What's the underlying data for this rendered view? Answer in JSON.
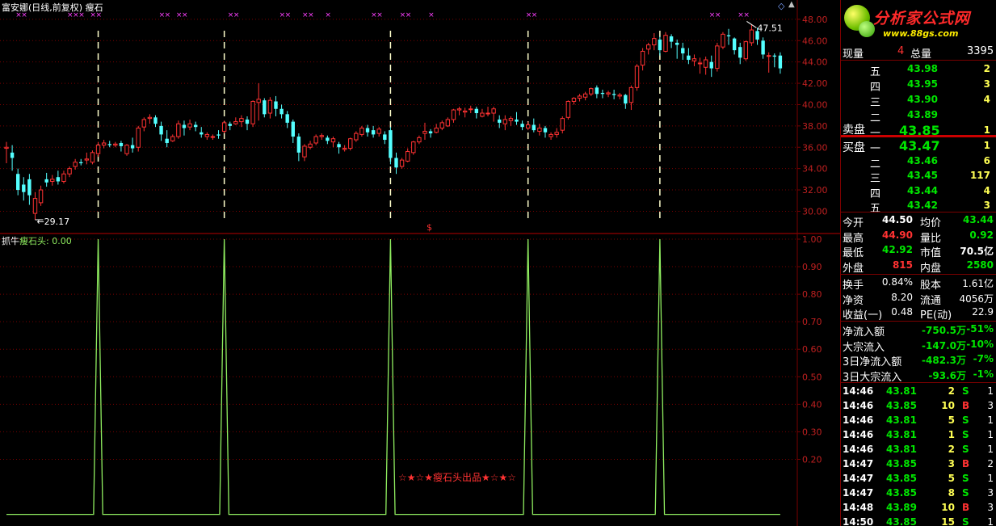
{
  "chart_header": {
    "title": "富安娜(日线,前复权) 瘦石",
    "indicator_name": "抓牛",
    "indicator_line": "瘦石头: 0.00",
    "watermark": "☆★☆★瘦石头出品★☆★☆",
    "max_label": "47.51",
    "min_label": "29.17",
    "marker": "$"
  },
  "colors": {
    "up": "#ff3232",
    "down": "#54ffff",
    "indicator": "#90ee60",
    "grid": "#7a0000",
    "axis_text": "#c02020"
  },
  "chart_data": [
    {
      "type": "candlestick",
      "y_ticks": [
        30,
        32,
        34,
        36,
        38,
        40,
        42,
        44,
        46,
        48
      ],
      "y_tick_labels": [
        "30.00",
        "32.00",
        "34.00",
        "36.00",
        "38.00",
        "40.00",
        "42.00",
        "44.00",
        "46.00",
        "48.00"
      ],
      "ylim": [
        29.2,
        48.9
      ],
      "candles": [
        [
          35.9,
          36.5,
          36.0,
          34.5
        ],
        [
          35.5,
          36.2,
          35.0,
          33.8
        ],
        [
          33.5,
          34.0,
          32.0,
          31.5
        ],
        [
          32.5,
          33.2,
          31.8,
          31.0
        ],
        [
          33.0,
          33.5,
          31.5,
          30.6
        ],
        [
          29.8,
          31.8,
          31.2,
          29.2
        ],
        [
          30.8,
          32.4,
          32.0,
          30.5
        ],
        [
          33.0,
          33.6,
          32.7,
          32.3
        ],
        [
          32.8,
          33.4,
          33.0,
          32.4
        ],
        [
          33.2,
          33.8,
          32.8,
          32.5
        ],
        [
          32.8,
          33.8,
          33.5,
          32.6
        ],
        [
          33.5,
          34.2,
          34.0,
          33.2
        ],
        [
          34.2,
          34.9,
          34.6,
          33.9
        ],
        [
          34.6,
          34.9,
          34.5,
          34.3
        ],
        [
          34.8,
          35.5,
          34.9,
          34.4
        ],
        [
          34.6,
          35.7,
          35.5,
          34.4
        ],
        [
          35.4,
          36.5,
          36.2,
          35.1
        ],
        [
          36.2,
          36.7,
          36.4,
          35.9
        ],
        [
          36.3,
          36.6,
          36.2,
          36.0
        ],
        [
          36.2,
          36.5,
          36.3,
          36.0
        ],
        [
          36.4,
          36.6,
          36.1,
          35.6
        ],
        [
          35.4,
          36.3,
          36.2,
          35.2
        ],
        [
          36.2,
          36.9,
          35.9,
          35.5
        ],
        [
          36.0,
          38.0,
          37.8,
          35.6
        ],
        [
          37.9,
          38.8,
          38.6,
          37.5
        ],
        [
          38.7,
          39.1,
          38.8,
          38.2
        ],
        [
          38.8,
          39.0,
          38.2,
          37.9
        ],
        [
          38.0,
          38.4,
          37.2,
          36.6
        ],
        [
          36.8,
          37.6,
          36.4,
          36.0
        ],
        [
          36.6,
          37.2,
          37.0,
          36.5
        ],
        [
          37.0,
          38.5,
          38.2,
          36.8
        ],
        [
          38.1,
          38.5,
          37.8,
          37.1
        ],
        [
          37.9,
          38.6,
          38.2,
          37.6
        ],
        [
          38.1,
          38.4,
          37.9,
          37.5
        ],
        [
          37.4,
          37.9,
          37.2,
          36.9
        ],
        [
          37.0,
          37.4,
          37.2,
          36.7
        ],
        [
          37.0,
          37.2,
          37.0,
          36.7
        ],
        [
          37.2,
          37.6,
          37.1,
          36.8
        ],
        [
          37.5,
          38.5,
          38.3,
          37.3
        ],
        [
          38.2,
          38.4,
          38.0,
          37.6
        ],
        [
          38.2,
          38.8,
          38.4,
          38.1
        ],
        [
          38.4,
          39.0,
          38.7,
          37.9
        ],
        [
          38.6,
          38.9,
          38.2,
          37.6
        ],
        [
          38.2,
          40.4,
          40.3,
          37.9
        ],
        [
          40.2,
          42.0,
          40.5,
          38.5
        ],
        [
          40.4,
          40.6,
          39.1,
          38.8
        ],
        [
          39.2,
          40.7,
          40.4,
          38.7
        ],
        [
          40.3,
          40.8,
          39.6,
          38.9
        ],
        [
          39.6,
          40.0,
          39.1,
          38.7
        ],
        [
          39.1,
          39.4,
          38.3,
          37.8
        ],
        [
          38.4,
          38.6,
          37.0,
          36.4
        ],
        [
          37.0,
          37.3,
          35.5,
          34.7
        ],
        [
          35.1,
          36.3,
          36.1,
          34.7
        ],
        [
          36.0,
          36.6,
          36.3,
          35.8
        ],
        [
          36.4,
          37.2,
          37.0,
          36.2
        ],
        [
          37.0,
          37.3,
          37.1,
          36.7
        ],
        [
          36.9,
          37.1,
          36.6,
          36.3
        ],
        [
          36.5,
          37.0,
          36.8,
          36.0
        ],
        [
          36.3,
          36.5,
          36.0,
          35.4
        ],
        [
          35.8,
          36.2,
          35.9,
          35.6
        ],
        [
          35.9,
          36.9,
          36.8,
          35.7
        ],
        [
          36.7,
          37.5,
          37.3,
          36.5
        ],
        [
          37.2,
          38.0,
          37.8,
          37.0
        ],
        [
          37.8,
          38.1,
          37.4,
          37.0
        ],
        [
          37.6,
          38.0,
          37.2,
          36.9
        ],
        [
          37.3,
          37.9,
          37.7,
          37.0
        ],
        [
          37.2,
          37.5,
          36.7,
          36.3
        ],
        [
          37.6,
          37.9,
          35.0,
          34.4
        ],
        [
          35.0,
          35.5,
          34.1,
          33.5
        ],
        [
          34.2,
          35.0,
          34.8,
          34.0
        ],
        [
          34.7,
          35.9,
          35.6,
          34.6
        ],
        [
          35.5,
          36.6,
          36.5,
          35.3
        ],
        [
          36.5,
          37.1,
          36.9,
          36.3
        ],
        [
          37.3,
          38.3,
          37.5,
          36.7
        ],
        [
          37.5,
          37.7,
          37.3,
          36.9
        ],
        [
          37.4,
          38.2,
          37.8,
          37.3
        ],
        [
          37.8,
          38.5,
          38.3,
          37.6
        ],
        [
          38.0,
          38.8,
          38.6,
          37.9
        ],
        [
          38.6,
          39.6,
          39.5,
          38.3
        ],
        [
          39.5,
          39.8,
          39.6,
          39.0
        ],
        [
          39.3,
          39.7,
          39.4,
          38.8
        ],
        [
          39.6,
          39.9,
          39.6,
          39.2
        ],
        [
          39.6,
          39.8,
          39.2,
          38.7
        ],
        [
          38.9,
          39.6,
          39.2,
          38.8
        ],
        [
          39.2,
          39.8,
          39.2,
          38.9
        ],
        [
          39.2,
          39.8,
          39.6,
          38.4
        ],
        [
          38.6,
          39.0,
          38.3,
          37.8
        ],
        [
          38.2,
          39.0,
          38.6,
          37.6
        ],
        [
          38.5,
          38.9,
          38.7,
          38.0
        ],
        [
          38.6,
          39.3,
          38.4,
          38.1
        ],
        [
          38.2,
          38.5,
          37.9,
          37.6
        ],
        [
          37.8,
          38.4,
          38.1,
          37.6
        ],
        [
          38.1,
          38.7,
          37.6,
          37.4
        ],
        [
          37.5,
          38.2,
          37.8,
          37.1
        ],
        [
          37.8,
          38.0,
          37.4,
          36.9
        ],
        [
          37.0,
          37.4,
          37.2,
          36.7
        ],
        [
          37.2,
          37.8,
          37.4,
          36.9
        ],
        [
          37.6,
          38.9,
          38.7,
          37.3
        ],
        [
          38.8,
          40.4,
          40.3,
          38.6
        ],
        [
          40.3,
          40.7,
          40.6,
          40.0
        ],
        [
          40.6,
          41.0,
          40.8,
          40.3
        ],
        [
          40.7,
          41.2,
          41.0,
          40.4
        ],
        [
          41.0,
          41.6,
          41.5,
          40.8
        ],
        [
          41.6,
          41.8,
          41.0,
          40.6
        ],
        [
          41.1,
          41.4,
          41.0,
          40.6
        ],
        [
          41.0,
          41.3,
          41.1,
          40.7
        ],
        [
          41.0,
          41.4,
          40.9,
          40.5
        ],
        [
          40.8,
          41.1,
          40.9,
          40.5
        ],
        [
          40.9,
          41.0,
          40.1,
          39.6
        ],
        [
          40.2,
          41.8,
          41.6,
          39.5
        ],
        [
          41.6,
          43.8,
          43.6,
          41.3
        ],
        [
          43.7,
          45.3,
          45.0,
          43.2
        ],
        [
          45.2,
          45.8,
          45.6,
          44.7
        ],
        [
          45.6,
          46.7,
          46.2,
          45.1
        ],
        [
          46.1,
          46.4,
          45.1,
          44.6
        ],
        [
          45.0,
          46.8,
          46.5,
          44.9
        ],
        [
          46.4,
          46.6,
          45.9,
          45.3
        ],
        [
          45.8,
          46.1,
          45.6,
          44.3
        ],
        [
          45.3,
          45.8,
          44.8,
          44.2
        ],
        [
          44.6,
          45.3,
          44.2,
          43.8
        ],
        [
          44.1,
          44.7,
          44.3,
          43.6
        ],
        [
          43.9,
          44.4,
          43.9,
          42.9
        ],
        [
          43.5,
          44.5,
          44.2,
          42.8
        ],
        [
          44.0,
          44.6,
          43.4,
          42.6
        ],
        [
          43.4,
          45.8,
          45.5,
          43.1
        ],
        [
          45.4,
          46.8,
          46.6,
          45.2
        ],
        [
          46.5,
          47.1,
          46.4,
          45.6
        ],
        [
          46.2,
          46.3,
          45.1,
          44.7
        ],
        [
          45.4,
          45.8,
          44.4,
          43.8
        ],
        [
          44.3,
          46.0,
          45.9,
          44.1
        ],
        [
          45.8,
          47.5,
          47.0,
          45.5
        ],
        [
          46.9,
          47.2,
          46.1,
          45.6
        ],
        [
          46.0,
          46.3,
          44.7,
          44.3
        ],
        [
          44.6,
          44.9,
          44.6,
          43.0
        ],
        [
          44.6,
          44.8,
          44.5,
          43.5
        ],
        [
          44.6,
          44.9,
          43.4,
          42.9
        ]
      ]
    },
    {
      "type": "line",
      "name": "瘦石头",
      "y_ticks": [
        0.2,
        0.3,
        0.4,
        0.5,
        0.6,
        0.7,
        0.8,
        0.9,
        1.0
      ],
      "y_tick_labels": [
        "0.20",
        "0.30",
        "0.40",
        "0.50",
        "0.60",
        "0.70",
        "0.80",
        "0.90",
        "1.00"
      ],
      "ylim": [
        -0.01,
        1.0
      ],
      "signal_candle_index": [
        16,
        38,
        67,
        91,
        114
      ]
    }
  ],
  "quote_panel": {
    "current_vol_label": "现量",
    "current_vol": "4",
    "total_vol_label": "总量",
    "total_vol": "3395",
    "sell_label": "卖盘",
    "buy_label": "买盘",
    "asks": [
      {
        "level": "五",
        "price": "43.98",
        "vol": "2"
      },
      {
        "level": "四",
        "price": "43.95",
        "vol": "3"
      },
      {
        "level": "三",
        "price": "43.90",
        "vol": "4"
      },
      {
        "level": "二",
        "price": "43.89",
        "vol": ""
      },
      {
        "level": "一",
        "price": "43.85",
        "vol": "1"
      }
    ],
    "bids": [
      {
        "level": "一",
        "price": "43.47",
        "vol": "1"
      },
      {
        "level": "二",
        "price": "43.46",
        "vol": "6"
      },
      {
        "level": "三",
        "price": "43.45",
        "vol": "117"
      },
      {
        "level": "四",
        "price": "43.44",
        "vol": "4"
      },
      {
        "level": "五",
        "price": "43.42",
        "vol": "3"
      }
    ],
    "stats": [
      {
        "l1": "今开",
        "v1": "44.50",
        "c1": "white",
        "l2": "均价",
        "v2": "43.44",
        "c2": "green"
      },
      {
        "l1": "最高",
        "v1": "44.90",
        "c1": "red",
        "l2": "量比",
        "v2": "0.92",
        "c2": "green"
      },
      {
        "l1": "最低",
        "v1": "42.92",
        "c1": "green",
        "l2": "市值",
        "v2": "70.5亿",
        "c2": "white"
      },
      {
        "l1": "外盘",
        "v1": "815",
        "c1": "red",
        "l2": "内盘",
        "v2": "2580",
        "c2": "green"
      }
    ],
    "stats2": [
      {
        "l1": "换手",
        "v1": "0.84%",
        "l2": "股本",
        "v2": "1.61亿"
      },
      {
        "l1": "净资",
        "v1": "8.20",
        "l2": "流通",
        "v2": "4056万"
      },
      {
        "l1": "收益(一)",
        "v1": "0.48",
        "l2": "PE(动)",
        "v2": "22.9"
      }
    ],
    "flows": [
      {
        "label": "净流入额",
        "value": "-750.5万",
        "pct": "-51%"
      },
      {
        "label": "大宗流入",
        "value": "-147.0万",
        "pct": "-10%"
      },
      {
        "label": "3日净流入额",
        "value": "-482.3万",
        "pct": "-7%"
      },
      {
        "label": "3日大宗流入",
        "value": "-93.6万",
        "pct": "-1%"
      }
    ],
    "ticks": [
      {
        "time": "14:46",
        "price": "43.81",
        "vol": "2",
        "side": "S",
        "n": "1"
      },
      {
        "time": "14:46",
        "price": "43.85",
        "vol": "10",
        "side": "B",
        "n": "3"
      },
      {
        "time": "14:46",
        "price": "43.81",
        "vol": "5",
        "side": "S",
        "n": "1"
      },
      {
        "time": "14:46",
        "price": "43.81",
        "vol": "1",
        "side": "S",
        "n": "1"
      },
      {
        "time": "14:46",
        "price": "43.81",
        "vol": "2",
        "side": "S",
        "n": "1"
      },
      {
        "time": "14:47",
        "price": "43.85",
        "vol": "3",
        "side": "B",
        "n": "2"
      },
      {
        "time": "14:47",
        "price": "43.85",
        "vol": "5",
        "side": "S",
        "n": "1"
      },
      {
        "time": "14:47",
        "price": "43.85",
        "vol": "8",
        "side": "S",
        "n": "3"
      },
      {
        "time": "14:48",
        "price": "43.89",
        "vol": "10",
        "side": "B",
        "n": "3"
      },
      {
        "time": "14:50",
        "price": "43.85",
        "vol": "15",
        "side": "S",
        "n": "1"
      }
    ]
  },
  "logo": {
    "name": "分析家公式网",
    "url": "www.88gs.com"
  }
}
